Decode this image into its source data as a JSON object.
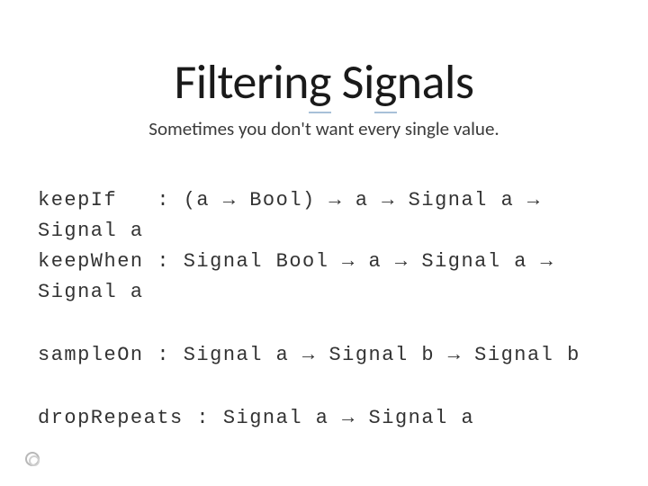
{
  "title_parts": {
    "a": "Filterin",
    "b": "g",
    "c": " Si",
    "d": "g",
    "e": "nals"
  },
  "subtitle": "Sometimes you don't want every single value.",
  "block1": {
    "l1": "keepIf   : (a → Bool) → a → Signal a →",
    "l2": "Signal a",
    "l3": "keepWhen : Signal Bool → a → Signal a →",
    "l4": "Signal a"
  },
  "block2": {
    "l1": "sampleOn : Signal a → Signal b → Signal b"
  },
  "block3": {
    "l1": "dropRepeats : Signal a → Signal a"
  }
}
